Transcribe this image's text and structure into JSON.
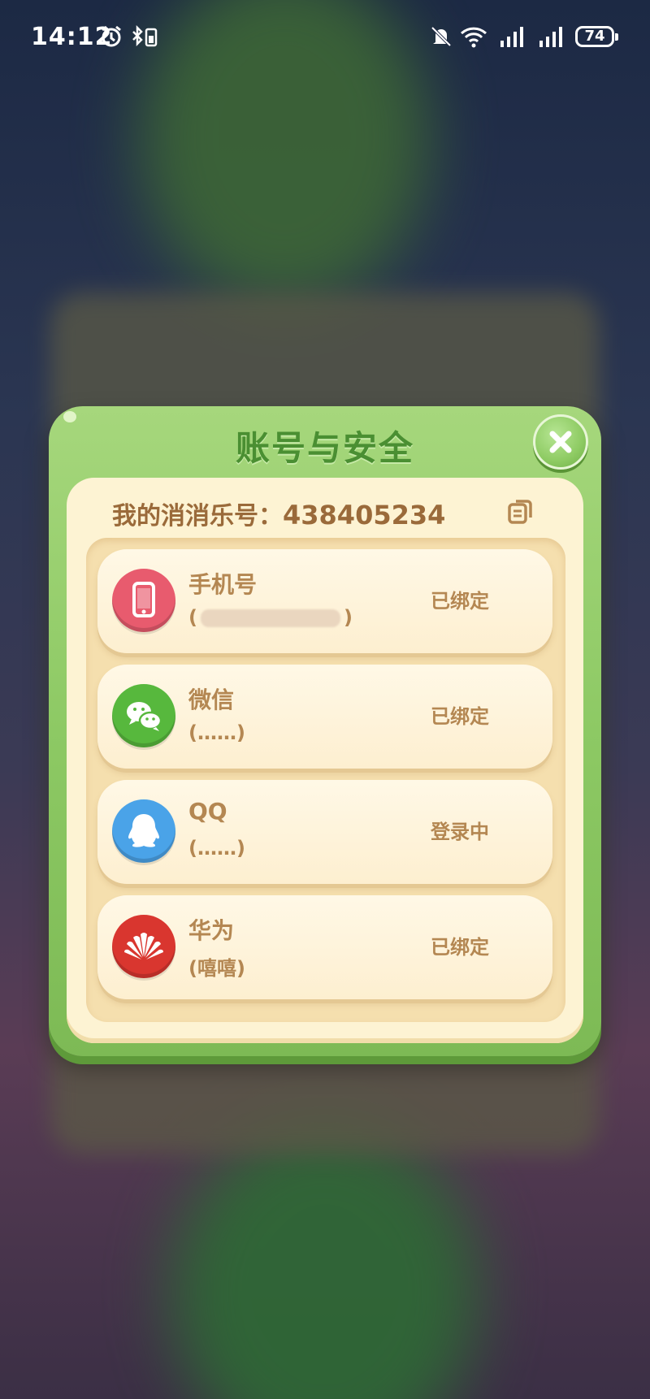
{
  "status_bar": {
    "time": "14:12",
    "battery": "74"
  },
  "dialog": {
    "title": "账号与安全",
    "account_label": "我的消消乐号：",
    "account_number": "438405234"
  },
  "bindings": [
    {
      "name": "手机号",
      "detail_open": "(",
      "detail_close": ")",
      "state": "已绑定",
      "icon": "phone-icon",
      "color": "#e85b6e"
    },
    {
      "name": "微信",
      "detail": "(……)",
      "state": "已绑定",
      "icon": "wechat-icon",
      "color": "#57b83d"
    },
    {
      "name": "QQ",
      "detail": "(……)",
      "state": "登录中",
      "icon": "qq-icon",
      "color": "#4aa3e8"
    },
    {
      "name": "华为",
      "detail": "(嘻嘻)",
      "state": "已绑定",
      "icon": "huawei-icon",
      "color": "#d9362f"
    }
  ]
}
